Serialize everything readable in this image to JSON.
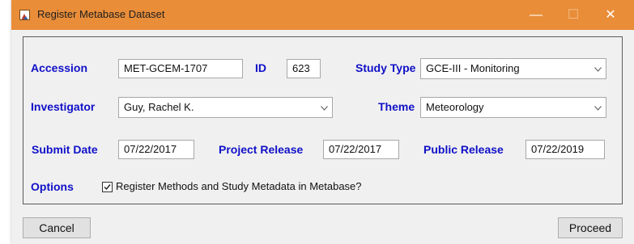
{
  "window": {
    "title": "Register Metabase Dataset",
    "controls": {
      "minimize": "—",
      "maximize": "☐",
      "close": "✕"
    }
  },
  "form": {
    "accession": {
      "label": "Accession",
      "value": "MET-GCEM-1707"
    },
    "id": {
      "label": "ID",
      "value": "623"
    },
    "study_type": {
      "label": "Study Type",
      "value": "GCE-III - Monitoring"
    },
    "investigator": {
      "label": "Investigator",
      "value": "Guy, Rachel K."
    },
    "theme": {
      "label": "Theme",
      "value": "Meteorology"
    },
    "submit_date": {
      "label": "Submit Date",
      "value": "07/22/2017"
    },
    "project_release": {
      "label": "Project Release",
      "value": "07/22/2017"
    },
    "public_release": {
      "label": "Public Release",
      "value": "07/22/2019"
    },
    "options": {
      "label": "Options",
      "checkbox_label": "Register Methods and Study Metadata in Metabase?",
      "checked": true
    }
  },
  "buttons": {
    "cancel": "Cancel",
    "proceed": "Proceed"
  },
  "colors": {
    "titlebar": "#e98d39",
    "label_blue": "#1010c8",
    "panel_bg": "#f0f0f0"
  },
  "icons": [
    "app-icon",
    "minimize-icon",
    "maximize-icon",
    "close-icon",
    "chevron-down-icon",
    "checkmark-icon"
  ]
}
